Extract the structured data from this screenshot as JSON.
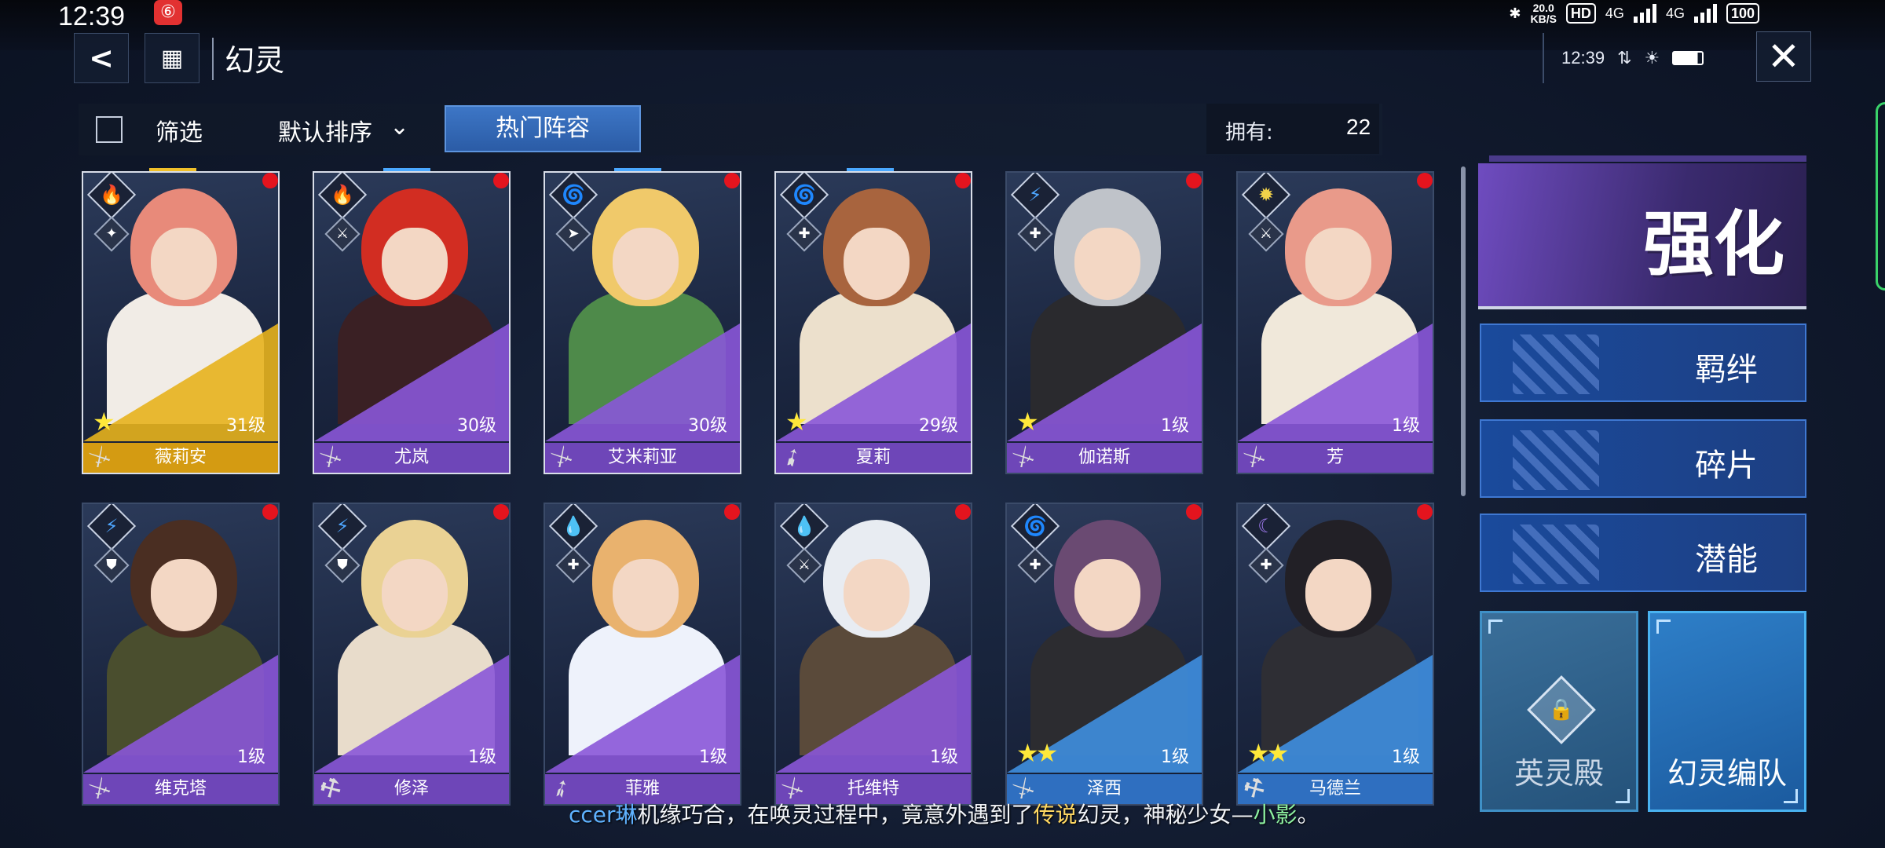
{
  "status_bar": {
    "time": "12:39",
    "app_badge": "⑥",
    "net_speed_value": "20.0",
    "net_speed_unit": "KB/S",
    "hd": "HD",
    "sig1": "4G",
    "sig2": "4G",
    "battery": "100"
  },
  "header": {
    "title": "幻灵",
    "back_icon": "back-arrow-icon",
    "menu_icon": "grid-menu-icon",
    "device_time": "12:39"
  },
  "filter_bar": {
    "filter_label": "筛选",
    "sort_label": "默认排序",
    "hot_label": "热门阵容",
    "own_label": "拥有:",
    "own_value": "22"
  },
  "cards": [
    {
      "name": "薇莉安",
      "level": "31级",
      "stars": "★",
      "element": "🔥",
      "elem_color": "#e0483a",
      "role": "✦",
      "tri": "#e7b21d",
      "strip": "#d49b12",
      "hair": "#e88a7a",
      "cloth": "#f1ece6",
      "weapon": "⚔",
      "dot": true,
      "selected": true
    },
    {
      "name": "尤岚",
      "level": "30级",
      "stars": "",
      "element": "🔥",
      "elem_color": "#e0483a",
      "role": "⚔",
      "tri": "#8a56d8",
      "strip": "#6e46b8",
      "hair": "#d22d22",
      "cloth": "#3a2024",
      "weapon": "⚔",
      "dot": true,
      "selected": true
    },
    {
      "name": "艾米莉亚",
      "level": "30级",
      "stars": "",
      "element": "🌀",
      "elem_color": "#38c26a",
      "role": "➤",
      "tri": "#8a56d8",
      "strip": "#6e46b8",
      "hair": "#f0c96a",
      "cloth": "#4e8a4a",
      "weapon": "⚔",
      "dot": true,
      "selected": true
    },
    {
      "name": "夏莉",
      "level": "29级",
      "stars": "★",
      "element": "🌀",
      "elem_color": "#38c26a",
      "role": "✚",
      "tri": "#8a56d8",
      "strip": "#6e46b8",
      "hair": "#a8643e",
      "cloth": "#ece0cc",
      "weapon": "➹",
      "dot": true,
      "selected": true
    },
    {
      "name": "伽诺斯",
      "level": "1级",
      "stars": "★",
      "element": "⚡",
      "elem_color": "#4ea6ff",
      "role": "✚",
      "tri": "#8a56d8",
      "strip": "#6e46b8",
      "hair": "#bfc3c9",
      "cloth": "#2a2a2e",
      "weapon": "⚔",
      "dot": true,
      "selected": false
    },
    {
      "name": "芳",
      "level": "1级",
      "stars": "",
      "element": "✹",
      "elem_color": "#f2d24a",
      "role": "⚔",
      "tri": "#8a56d8",
      "strip": "#6e46b8",
      "hair": "#e99a8a",
      "cloth": "#f0e8da",
      "weapon": "⚔",
      "dot": true,
      "selected": false
    },
    {
      "name": "维克塔",
      "level": "1级",
      "stars": "",
      "element": "⚡",
      "elem_color": "#4ea6ff",
      "role": "⛊",
      "tri": "#8a56d8",
      "strip": "#6e46b8",
      "hair": "#4a2e22",
      "cloth": "#4a4e2e",
      "weapon": "⚔",
      "dot": true,
      "selected": false
    },
    {
      "name": "修泽",
      "level": "1级",
      "stars": "",
      "element": "⚡",
      "elem_color": "#4ea6ff",
      "role": "⛊",
      "tri": "#8a56d8",
      "strip": "#6e46b8",
      "hair": "#ead294",
      "cloth": "#e8dccb",
      "weapon": "⚒",
      "dot": true,
      "selected": false
    },
    {
      "name": "菲雅",
      "level": "1级",
      "stars": "",
      "element": "💧",
      "elem_color": "#39c4d8",
      "role": "✚",
      "tri": "#8a56d8",
      "strip": "#6e46b8",
      "hair": "#e9b26e",
      "cloth": "#eef2fb",
      "weapon": "➶",
      "dot": true,
      "selected": false
    },
    {
      "name": "托维特",
      "level": "1级",
      "stars": "",
      "element": "💧",
      "elem_color": "#39c4d8",
      "role": "⚔",
      "tri": "#8a56d8",
      "strip": "#6e46b8",
      "hair": "#e8ecf2",
      "cloth": "#5a4a3a",
      "weapon": "⚔",
      "dot": true,
      "selected": false
    },
    {
      "name": "泽西",
      "level": "1级",
      "stars": "★★",
      "element": "🌀",
      "elem_color": "#38c26a",
      "role": "✚",
      "tri": "#3f8fe0",
      "strip": "#2f6fc0",
      "hair": "#6a4a72",
      "cloth": "#2c2c30",
      "weapon": "⚔",
      "dot": true,
      "selected": false
    },
    {
      "name": "马德兰",
      "level": "1级",
      "stars": "★★",
      "element": "☾",
      "elem_color": "#a07af0",
      "role": "✚",
      "tri": "#3f8fe0",
      "strip": "#2f6fc0",
      "hair": "#222026",
      "cloth": "#2e2e34",
      "weapon": "⚒",
      "dot": true,
      "selected": false
    }
  ],
  "right_panel": {
    "enhance_label": "强化",
    "bond_label": "羁绊",
    "shard_label": "碎片",
    "potential_label": "潜能",
    "hall_label": "英灵殿",
    "team_label": "幻灵编队",
    "lock_icon": "lock-icon"
  },
  "subtitle": {
    "speaker": "ccer琳",
    "part1": "机缘巧合，在唤灵过程中，竟意外遇到了",
    "highlight": "传说",
    "part2": "幻灵，神秘少女—",
    "name": "小影",
    "end": "。"
  },
  "colors": {
    "accent_purple": "#8a56d8",
    "accent_blue": "#3d76c6",
    "notify_red": "#e4141e"
  }
}
